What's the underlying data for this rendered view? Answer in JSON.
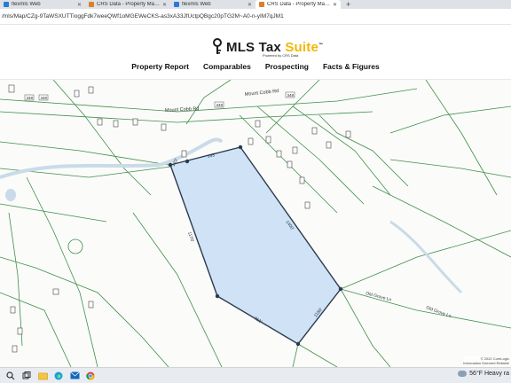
{
  "browser": {
    "tabs": [
      {
        "title": "flexmls Web",
        "favicon_color": "#2a7bd6",
        "active": false
      },
      {
        "title": "CRS Data - Property Map for Mi",
        "favicon_color": "#d9822b",
        "active": false
      },
      {
        "title": "flexmls Web",
        "favicon_color": "#2a7bd6",
        "active": false
      },
      {
        "title": "CRS Data - Property Map for Mi",
        "favicon_color": "#d9822b",
        "active": true
      }
    ],
    "new_tab_label": "+",
    "url": "/mls/Map/CZg-9TaWSXUTTioggFdk7weeQWf1oMGEWeCKS-as3xA33JfUctpQBgc20pTG2M~A0-n-yIM7qJM1"
  },
  "site": {
    "logo_main": "MLS Tax ",
    "logo_accent": "Suite",
    "logo_tm": "™",
    "logo_sub": "Powered by CRS Data",
    "brand_accent": "#f2b705",
    "nav": [
      "Property Report",
      "Comparables",
      "Prospecting",
      "Facts & Figures"
    ]
  },
  "map": {
    "parcel_fill": "#cfe2f6",
    "parcel_stroke": "#2b3a4d",
    "line_color": "#3f8f4a",
    "road_labels": [
      {
        "text": "Mount Cobb Rd"
      },
      {
        "text": "Mount Cobb Rd"
      },
      {
        "text": "Old Grove Ln"
      },
      {
        "text": "Old Grove Ln"
      }
    ],
    "route_shields": [
      "348",
      "348",
      "348",
      "348"
    ],
    "side_labels": [
      "143'",
      "1400'",
      "1170'",
      "761'",
      "1180'",
      "133'"
    ],
    "copyright_lines": [
      "© 2022 CoreLogic",
      "Information Deemed Reliable"
    ]
  },
  "taskbar": {
    "weather_temp": "56°F",
    "weather_desc": "Heavy ra"
  }
}
